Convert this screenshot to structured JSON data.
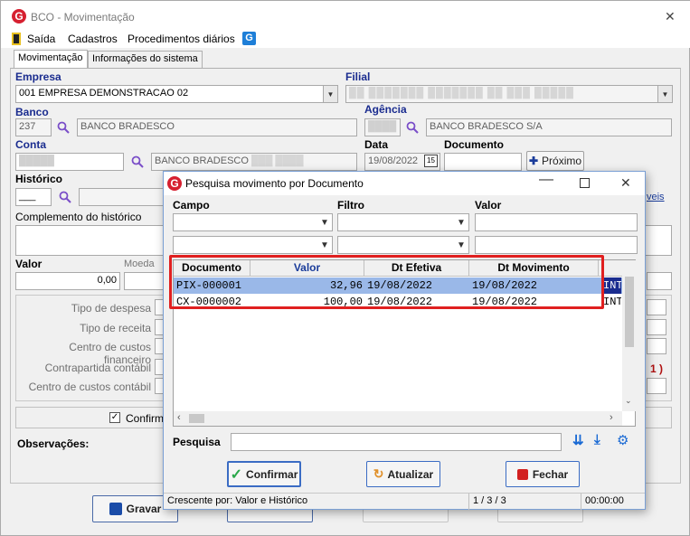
{
  "window": {
    "title": "BCO - Movimentação",
    "close": "✕"
  },
  "menu": {
    "items": [
      "Saída",
      "Cadastros",
      "Procedimentos diários"
    ]
  },
  "tabs": [
    "Movimentação",
    "Informações do sistema"
  ],
  "form": {
    "empresa_label": "Empresa",
    "empresa_value": "001 EMPRESA DEMONSTRACAO 02",
    "filial_label": "Filial",
    "banco_label": "Banco",
    "banco_code": "237",
    "banco_name": "BANCO BRADESCO",
    "agencia_label": "Agência",
    "agencia_name": "BANCO BRADESCO S/A",
    "conta_label": "Conta",
    "conta_name": "BANCO BRADESCO",
    "data_label": "Data",
    "data_value": "19/08/2022",
    "documento_label": "Documento",
    "proximo_label": "Próximo",
    "historico_label": "Histórico",
    "complemento_label": "Complemento do histórico",
    "valor_label": "Valor",
    "valor_value": "0,00",
    "moeda_label": "Moeda",
    "tipo_despesa": "Tipo de despesa",
    "tipo_receita": "Tipo de receita",
    "centro_custos_fin": "Centro de custos financeiro",
    "contrapartida": "Contrapartida contábil",
    "centro_custos_cont": "Centro de custos contábil",
    "confirma_label": "Confirma",
    "observacoes_label": "Observações:",
    "gravar_label": "Gravar",
    "link_fragment": "veis",
    "paren_fragment": "1 )"
  },
  "dialog": {
    "title": "Pesquisa movimento por Documento",
    "campo_label": "Campo",
    "filtro_label": "Filtro",
    "valor_label": "Valor",
    "columns": [
      "Documento",
      "Valor",
      "Dt Efetiva",
      "Dt Movimento"
    ],
    "rows": [
      {
        "doc": "PIX-000001",
        "valor": "32,96",
        "dt_efetiva": "19/08/2022",
        "dt_mov": "19/08/2022",
        "extra": "INT"
      },
      {
        "doc": "CX-0000002",
        "valor": "100,00",
        "dt_efetiva": "19/08/2022",
        "dt_mov": "19/08/2022",
        "extra": "INT"
      }
    ],
    "pesquisa_label": "Pesquisa",
    "confirmar_label": "Confirmar",
    "atualizar_label": "Atualizar",
    "fechar_label": "Fechar",
    "status_sort": "Crescente por: Valor e Histórico",
    "status_count": "1 / 3 / 3",
    "status_time": "00:00:00"
  },
  "colors": {
    "accent_label": "#1a2c8f",
    "selected_row": "#9ab8e8",
    "highlight_box": "#e02020",
    "logo_red": "#d62030"
  }
}
